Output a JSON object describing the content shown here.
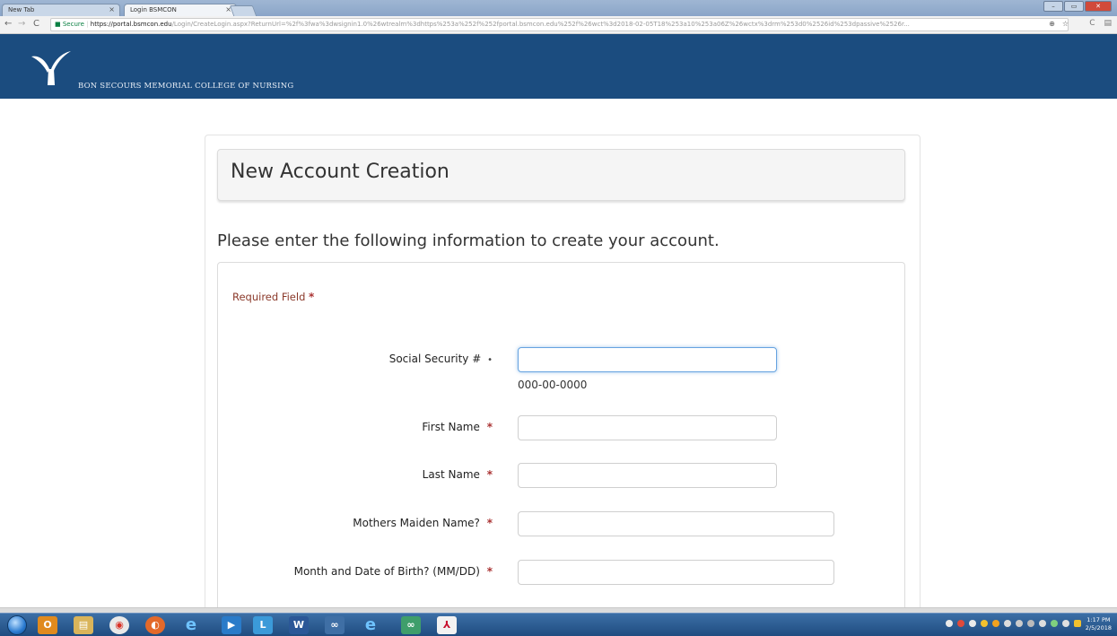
{
  "browser": {
    "tabs": [
      {
        "label": "New Tab"
      },
      {
        "label": "Login BSMCON"
      }
    ],
    "close_glyph": "×",
    "url": {
      "secure_label": "Secure",
      "host": "https://portal.bsmcon.edu",
      "path": "/Login/CreateLogin.aspx?ReturnUrl=%2f%3fwa%3dwsignin1.0%26wtrealm%3dhttps%253a%252f%252fportal.bsmcon.edu%252f%26wct%3d2018-02-05T18%253a10%253a06Z%26wctx%3drm%253d0%2526id%253dpassive%2526r..."
    }
  },
  "site": {
    "org_name": "BON SECOURS MEMORIAL COLLEGE OF NURSING",
    "brand_color": "#1b4c7f"
  },
  "page": {
    "heading": "New Account Creation",
    "intro": "Please enter the following information to create your account.",
    "required_note": "Required Field",
    "required_marker": "*",
    "optional_marker": "•"
  },
  "form": {
    "ssn": {
      "label": "Social Security #",
      "hint": "000-00-0000",
      "value": ""
    },
    "first_name": {
      "label": "First Name",
      "value": ""
    },
    "last_name": {
      "label": "Last Name",
      "value": ""
    },
    "maiden_name": {
      "label": "Mothers Maiden Name?",
      "value": ""
    },
    "birth_date": {
      "label": "Month and Date of Birth? (MM/DD)",
      "value": ""
    }
  },
  "taskbar": {
    "icons": [
      "outlook-icon",
      "explorer-icon",
      "chrome-icon",
      "firefox-icon",
      "ie-icon",
      "media-icon",
      "lync-icon",
      "word-icon",
      "app-icon",
      "ie-icon",
      "app-icon",
      "acrobat-icon"
    ],
    "clock_time": "1:17 PM",
    "clock_date": "2/5/2018"
  }
}
